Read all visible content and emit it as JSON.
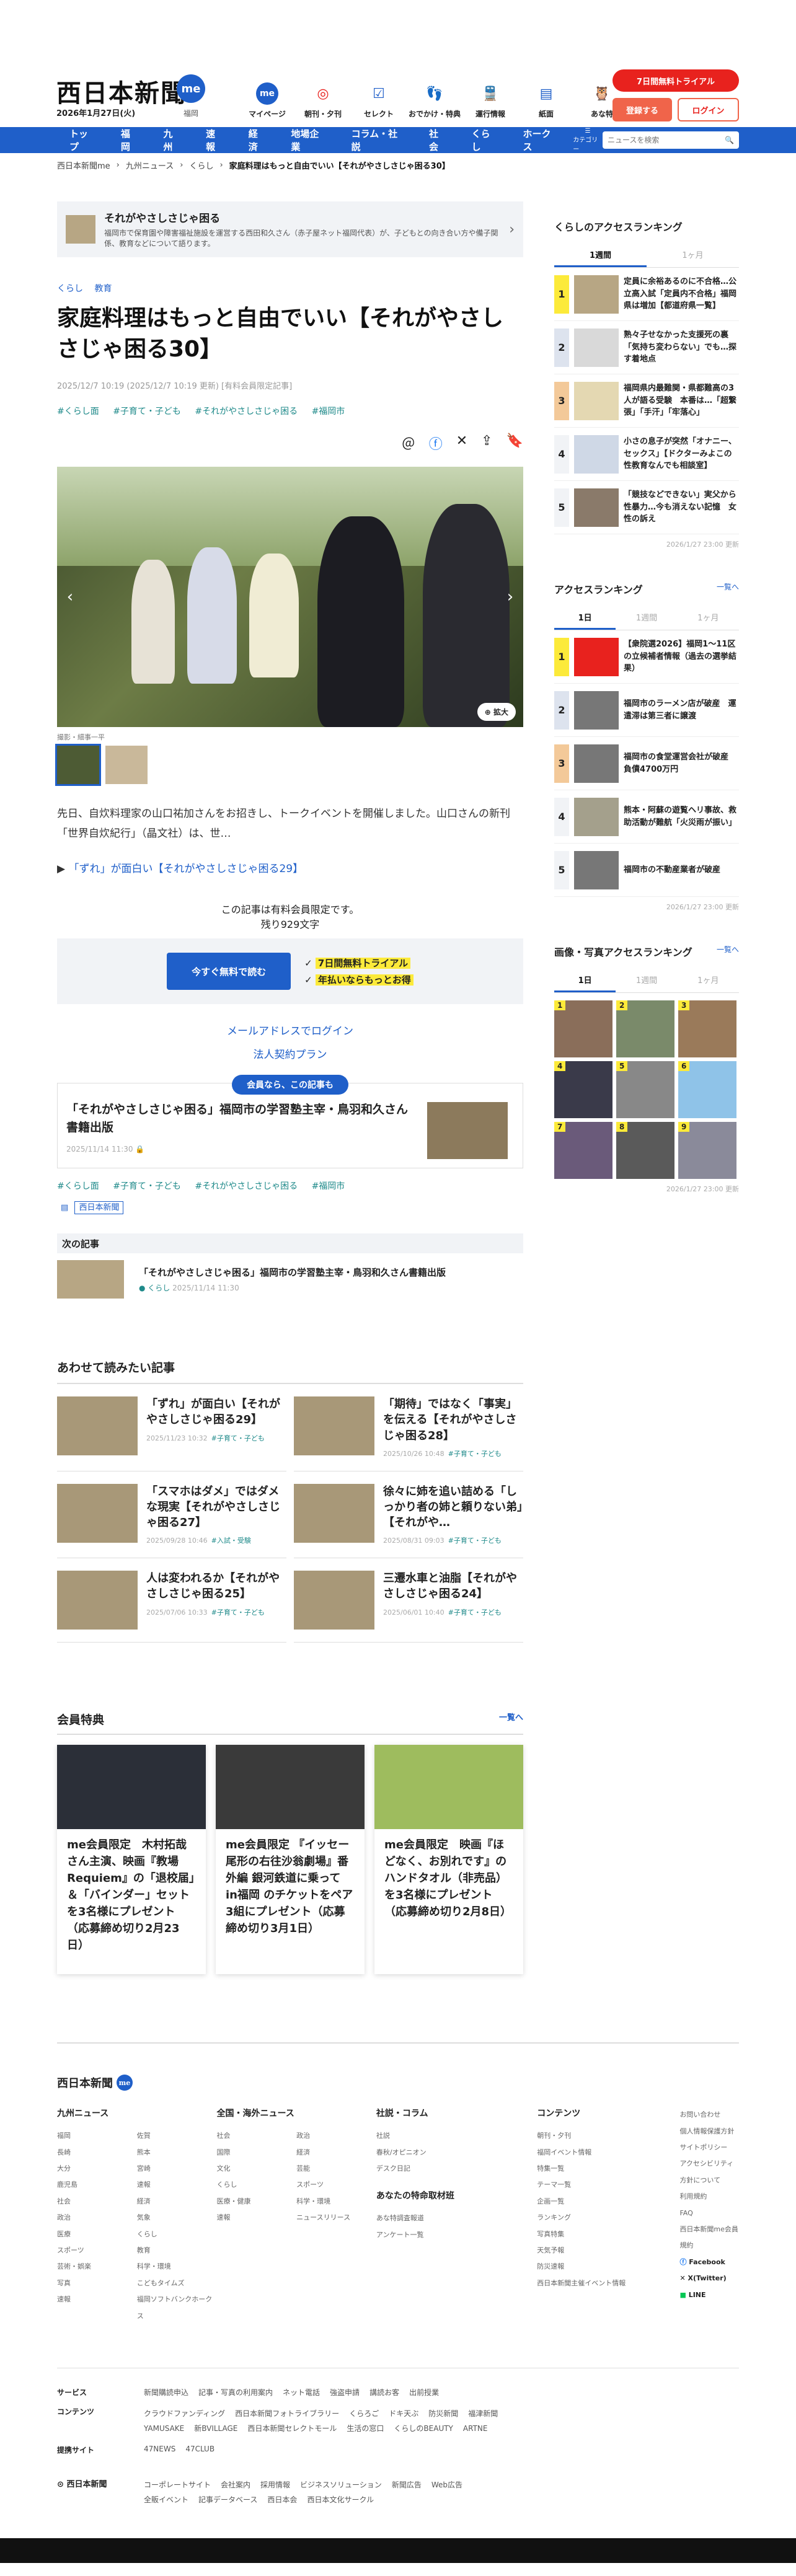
{
  "header": {
    "logo": "西日本新聞",
    "logo_me": "me",
    "date": "2026年1月27日(火)",
    "area": "福岡",
    "nav": [
      {
        "label": "マイページ",
        "icon": "me-icon"
      },
      {
        "label": "朝刊・夕刊",
        "icon": "newspaper-icon"
      },
      {
        "label": "セレクト",
        "icon": "select-icon"
      },
      {
        "label": "おでかけ・特典",
        "icon": "footprint-icon"
      },
      {
        "label": "運行情報",
        "icon": "train-icon"
      },
      {
        "label": "紙面",
        "icon": "paper-icon"
      },
      {
        "label": "あな特",
        "icon": "owl-icon"
      }
    ],
    "trial": "7日間無料トライアル",
    "register": "登録する",
    "login": "ログイン"
  },
  "mainnav": {
    "items": [
      "トップ",
      "福岡",
      "九州",
      "速報",
      "経済",
      "地場企業",
      "コラム・社説",
      "社会",
      "くらし",
      "ホークス"
    ],
    "category": "カテゴリー",
    "search_placeholder": "ニュースを検索"
  },
  "breadcrumb": [
    "西日本新聞me",
    "九州ニュース",
    "くらし",
    "家庭料理はもっと自由でいい【それがやさしさじゃ困る30】"
  ],
  "series": {
    "title": "それがやさしさじゃ困る",
    "desc": "福岡市で保育園や障害福祉施設を運営する西田和久さん（赤子屋ネット福岡代表）が、子どもとの向き合い方や備子関係、教育などについて語ります。"
  },
  "article": {
    "categories": [
      "くらし",
      "教育"
    ],
    "title": "家庭料理はもっと自由でいい【それがやさしさじゃ困る30】",
    "date": "2025/12/7 10:19 (2025/12/7 10:19 更新) [有料会員限定記事]",
    "hashtags": [
      "#くらし面",
      "#子育て・子ども",
      "#それがやさしさじゃ困る",
      "#福岡市"
    ],
    "photo_zoom": "拡大",
    "credit": "撮影・細事一平",
    "lead": "先日、自炊料理家の山口祐加さんをお招きし、トークイベントを開催しました。山口さんの新刊「世界自炊紀行」（晶文社）は、世…",
    "related": "「ずれ」が面白い【それがやさしさじゃ困る29】",
    "paywall_1": "この記事は有料会員限定です。",
    "paywall_2": "残り929文字",
    "read_free": "今すぐ無料で読む",
    "point_1": "7日間無料トライアル",
    "point_2": "年払いならもっとお得",
    "login_mail": "メールアドレスでログイン",
    "corporate": "法人契約プラン",
    "member_tag": "会員なら、この記事も",
    "member_title": "「それがやさしさじゃ困る」福岡市の学習塾主宰・鳥羽和久さん書籍出版",
    "member_date": "2025/11/14 11:30",
    "hashtags_bottom": [
      "#くらし面",
      "#子育て・子ども",
      "#それがやさしさじゃ困る",
      "#福岡市"
    ],
    "publisher": "西日本新聞"
  },
  "next": {
    "heading": "次の記事",
    "title": "「それがやさしさじゃ困る」福岡市の学習塾主宰・鳥羽和久さん書籍出版",
    "tag": "くらし",
    "date": "2025/11/14 11:30"
  },
  "more": {
    "heading": "あわせて読みたい記事",
    "items": [
      {
        "title": "「ずれ」が面白い【それがやさしさじゃ困る29】",
        "date": "2025/11/23 10:32",
        "tag": "#子育て・子ども"
      },
      {
        "title": "「期待」ではなく「事実」を伝える【それがやさしさじゃ困る28】",
        "date": "2025/10/26 10:48",
        "tag": "#子育て・子ども"
      },
      {
        "title": "「スマホはダメ」ではダメな現実【それがやさしさじゃ困る27】",
        "date": "2025/09/28 10:46",
        "tag": "#入試・受験"
      },
      {
        "title": "徐々に姉を追い詰める「しっかり者の姉と頼りない弟」【それがや…",
        "date": "2025/08/31 09:03",
        "tag": "#子育て・子ども"
      },
      {
        "title": "人は変われるか【それがやさしさじゃ困る25】",
        "date": "2025/07/06 10:33",
        "tag": "#子育て・子ども"
      },
      {
        "title": "三遷水車と油脂【それがやさしさじゃ困る24】",
        "date": "2025/06/01 10:40",
        "tag": "#子育て・子ども"
      }
    ]
  },
  "perks": {
    "heading": "会員特典",
    "more": "一覧へ",
    "items": [
      "me会員限定　木村拓哉さん主演、映画『教場 Requiem』の「退校届」＆「バインダー」セットを3名様にプレゼント（応募締め切り2月23日）",
      "me会員限定 『イッセー尾形の右往沙翁劇場』番外編 銀河鉄道に乗って in福岡 のチケットをペア3組にプレゼント（応募締め切り3月1日）",
      "me会員限定　映画『ほどなく、お別れです』のハンドタオル（非売品）を3名様にプレゼント（応募締め切り2月8日）"
    ]
  },
  "side": {
    "kurashi_heading": "くらしのアクセスランキング",
    "kurashi_tabs": [
      "1週間",
      "1ヶ月"
    ],
    "kurashi_items": [
      "定員に余裕あるのに不合格…公立高入試「定員内不合格」福岡県は増加【都道府県一覧】",
      "熟々子せなかった支援死の裏 「気持ち変わらない」でも…探す着地点",
      "福岡県内最難関・県都難高の3人が語る受験　本番は…「超繋張」「手汗」「牢落心」",
      "小さの息子が突然「オナニー、セックス」【ドクターみよこの性教育なんでも相談室】",
      "「競技などできない」実父から性暴力…今も消えない記憶　女性の訴え"
    ],
    "kurashi_updated": "2026/1/27 23:00 更新",
    "access_heading": "アクセスランキング",
    "access_more": "一覧へ",
    "access_tabs": [
      "1日",
      "1週間",
      "1ヶ月"
    ],
    "access_items": [
      "【衆院選2026】福岡1～11区の立候補者情報（過去の選挙結果）",
      "福岡市のラーメン店が破産　運遣滞は第三者に譲渡",
      "福岡市の食堂運営会社が破産　負債4700万円",
      "熊本・阿蘇の遊覧ヘリ事故、救助活動が難航「火災雨が振い」",
      "福岡市の不動産業者が破産"
    ],
    "access_updated": "2026/1/27 23:00 更新",
    "image_heading": "画像・写真アクセスランキング",
    "image_more": "一覧へ",
    "image_tabs": [
      "1日",
      "1週間",
      "1ヶ月"
    ],
    "image_ranks": [
      "1",
      "2",
      "3",
      "4",
      "5",
      "6",
      "7",
      "8",
      "9"
    ],
    "image_updated": "2026/1/27 23:00 更新"
  },
  "footer": {
    "logo": "西日本新聞",
    "kyushu_h": "九州ニュース",
    "kyushu": [
      "福岡",
      "佐賀",
      "長崎",
      "熊本",
      "大分",
      "宮崎",
      "鹿児島",
      "速報",
      "社会",
      "経済",
      "政治",
      "気象",
      "医療",
      "くらし",
      "スポーツ",
      "教育",
      "芸術・娯楽",
      "科学・環境",
      "写真",
      "こどもタイムズ",
      "速報",
      "福岡ソフトバンクホークス"
    ],
    "national_h": "全国・海外ニュース",
    "national": [
      "社会",
      "政治",
      "国際",
      "経済",
      "文化",
      "芸能",
      "くらし",
      "スポーツ",
      "医療・健康",
      "科学・環境",
      "速報",
      "ニュースリリース"
    ],
    "column_h": "社説・コラム",
    "column": [
      "社説",
      "春秋/オピニオン",
      "デスク日記"
    ],
    "anaToku_h": "あなたの特命取材班",
    "anaToku": [
      "あな特調査報道",
      "アンケート一覧"
    ],
    "contents_h": "コンテンツ",
    "contents": [
      "朝刊・夕刊",
      "福岡イベント情報",
      "特集一覧",
      "テーマ一覧",
      "企画一覧",
      "ランキング",
      "写真特集",
      "天気予報",
      "防災速報",
      "西日本新聞主催イベント情報"
    ],
    "misc": [
      "お問い合わせ",
      "個人情報保護方針",
      "サイトポリシー",
      "アクセシビリティ方針について",
      "利用規約",
      "FAQ",
      "西日本新聞me会員規約"
    ],
    "social": [
      "Facebook",
      "X(Twitter)",
      "LINE"
    ],
    "service_label": "サービス",
    "service": [
      "新聞購読申込",
      "記事・写真の利用案内",
      "ネット電話",
      "強盗申請",
      "講読お客",
      "出前授業"
    ],
    "contents_label": "コンテンツ",
    "contents_row": [
      "クラウドファンディング",
      "西日本新聞フォトライブラリー",
      "くらろご",
      "ドキ天ぶ",
      "防災新聞",
      "福津新聞",
      "YAMUSAKE",
      "新BVILLAGE",
      "西日本新聞セレクトモール",
      "生活の窓口",
      "くらしのBEAUTY",
      "ARTNE"
    ],
    "partner_label": "提携サイト",
    "partner": [
      "47NEWS",
      "47CLUB"
    ],
    "bottom_logo": "西日本新聞",
    "bottom_links": [
      "コーポレートサイト",
      "会社案内",
      "採用情報",
      "ビジネスソリューション",
      "新聞広告",
      "Web広告",
      "全販イベント",
      "記事データベース",
      "西日本会",
      "西日本文化サークル"
    ]
  }
}
